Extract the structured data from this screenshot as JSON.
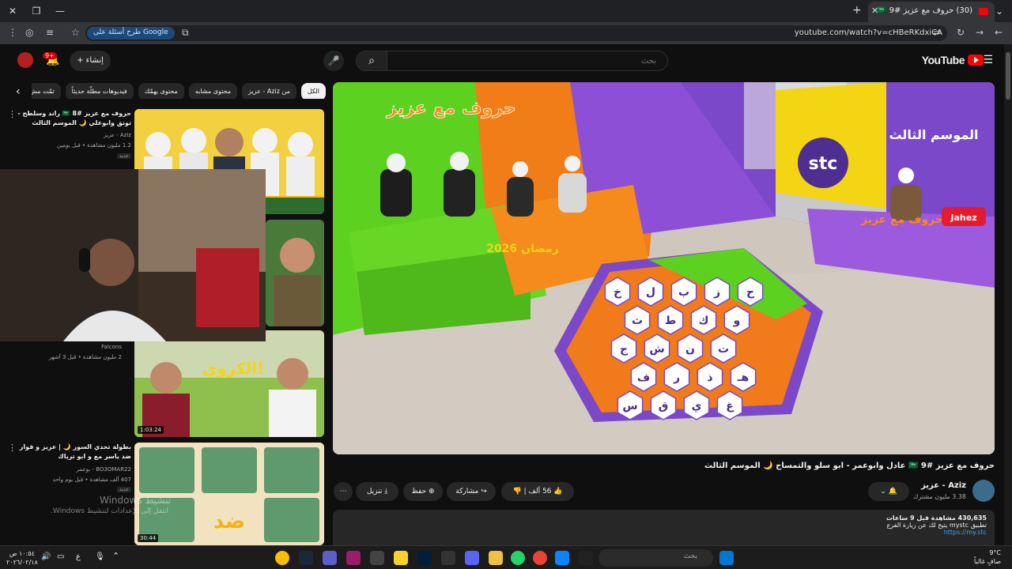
{
  "browser": {
    "tab_title": "(30) حروف مع عزيز #9 🇸🇦",
    "url": "youtube.com/watch?v=cHBeRKdxiCA",
    "ask_google": "طرح أسئلة على Google"
  },
  "header": {
    "logo": "YouTube",
    "search_placeholder": "بحث",
    "create_label": "إنشاء",
    "notif_count": "9+"
  },
  "chips": [
    "الكل",
    "من Aziz - عزيز",
    "محتوى مشابه",
    "محتوى يهمّك",
    "فيديوهات مطلّة حديثاً",
    "تمّت مش"
  ],
  "sidebar": [
    {
      "title": "حروف مع عزيز #8 🇸🇦 راند وسلطح - تونق وابوعلي 🌙 الموسم الثالث",
      "channel": "Aziz - عزيز",
      "views": "1.2 مليون مشاهدة • قبل يومين",
      "badge": "جديد",
      "duration": ""
    },
    {
      "title": "",
      "channel": "Falcons",
      "views": "2 مليون مشاهدة • قبل 3 أشهر",
      "badge": "",
      "duration": "1:03:24"
    },
    {
      "title": "بطولة تحدي السور 🌙 | عزيز و فواز ضد ياسر مع و ابو ترياك",
      "channel": "BO3OMAR22 - بوعمر",
      "views": "407 ألف مشاهدة • قبل يوم واحد",
      "badge": "جديد",
      "duration": "30:44"
    }
  ],
  "video": {
    "title": "حروف مع عزيز #9 🇸🇦 عادل وابوعمر - ابو سلو والتمساح 🌙 الموسم الثالث",
    "channel": "Aziz - عزيز",
    "subscribers": "3.38 مليون مشترك",
    "likes": "56 ألف",
    "share": "مشاركة",
    "save": "حفظ",
    "download": "تنزيل",
    "desc_stats": "430,635 مشاهدة قبل 9 ساعات",
    "desc_line2": "تطبيق mystc يتيح لك عن زيارة الفرع",
    "desc_link": "https://my.stc"
  },
  "game": {
    "show_title": "حروف مع عزيز",
    "season": "الموسم الثالث",
    "ramadan": "رمضان 2026",
    "sponsor1": "stc",
    "sponsor2": "Jahez",
    "letters": [
      "خ",
      "ل",
      "ب",
      "ز",
      "ح",
      "ث",
      "ط",
      "ك",
      "و",
      "ج",
      "ش",
      "ن",
      "ت",
      "ف",
      "ر",
      "ذ",
      "هـ",
      "س",
      "ق",
      "ي",
      "غ"
    ]
  },
  "watermark": {
    "line1": "تنشيط Windows",
    "line2": "انتقل إلى الإعدادات لتنشيط Windows."
  },
  "taskbar": {
    "search": "بحث",
    "time": "١٠:٥٤ ص",
    "date": "٢٠٢٦/٠٢/١٨",
    "temp": "9°C",
    "weather": "صافٍ غالباً",
    "lang": "ع"
  },
  "colors": {
    "accent": "#ff0000",
    "bg": "#0f0f0f",
    "chip": "#272727"
  }
}
